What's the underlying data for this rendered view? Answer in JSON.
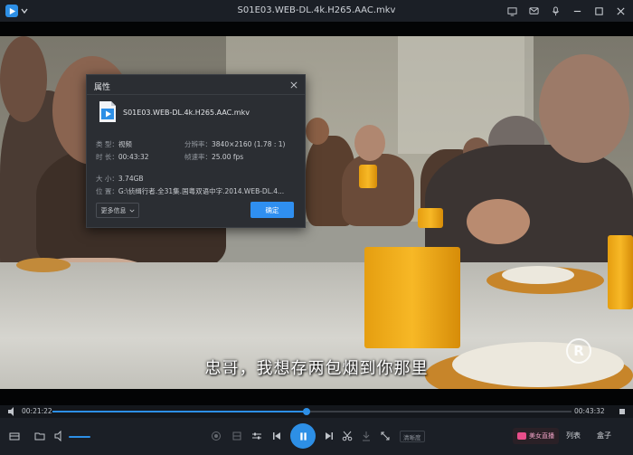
{
  "window": {
    "title": "S01E03.WEB-DL.4k.H265.AAC.mkv"
  },
  "video": {
    "subtitle": "忠哥，我想存两包烟到你那里",
    "watermark": "R"
  },
  "dialog": {
    "title": "属性",
    "file_name": "S01E03.WEB-DL.4k.H265.AAC.mkv",
    "type_label": "类 型：",
    "type_value": "视频",
    "resolution_label": "分辨率：",
    "resolution_value": "3840×2160 (1.78 : 1)",
    "duration_label": "时 长：",
    "duration_value": "00:43:32",
    "framerate_label": "帧速率：",
    "framerate_value": "25.00 fps",
    "size_label": "大 小：",
    "size_value": "3.74GB",
    "location_label": "位 置：",
    "location_value": "G:\\侦缉行者.全31集.国粤双语中字.2014.WEB-DL.4...",
    "more_info_label": "更多信息",
    "ok_label": "确定"
  },
  "playback": {
    "current_time": "00:21:22",
    "total_time": "00:43:32",
    "progress_fraction": 0.49,
    "volume_fraction": 1.0
  },
  "controls": {
    "quality_chip": "清晰度",
    "live_label": "美女直播",
    "list_label": "列表",
    "box_label": "盒子"
  },
  "colors": {
    "accent": "#2d8fe6",
    "chrome": "#1b1f26",
    "dialog_bg": "#2b2e33"
  }
}
